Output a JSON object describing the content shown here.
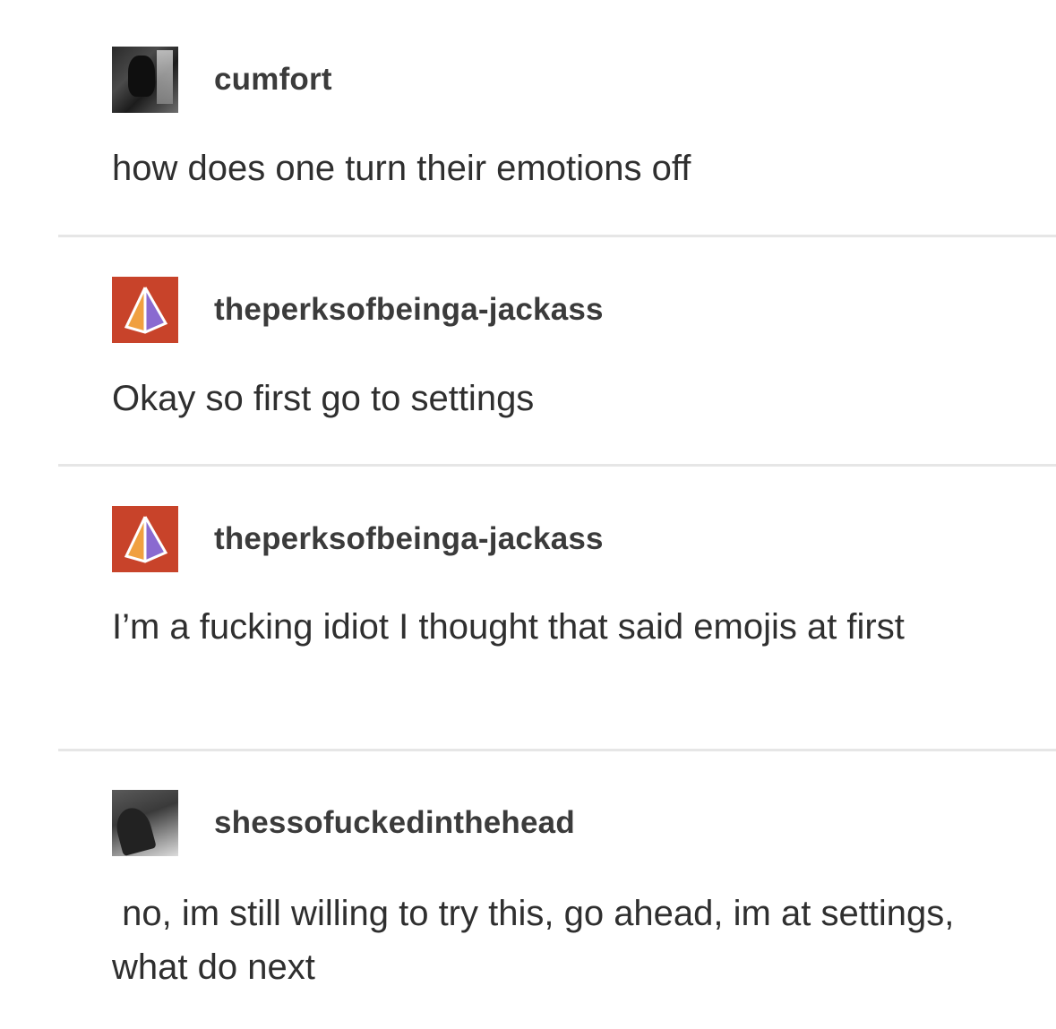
{
  "posts": [
    {
      "username": "cumfort",
      "avatar_icon": "user-photo-dark",
      "text": "how does one turn their emotions off"
    },
    {
      "username": "theperksofbeinga-jackass",
      "avatar_icon": "pyramid-icon",
      "text": "Okay so first go to settings"
    },
    {
      "username": "theperksofbeinga-jackass",
      "avatar_icon": "pyramid-icon",
      "text": "I’m a fucking idiot I thought that said emojis at first"
    },
    {
      "username": "shessofuckedinthehead",
      "avatar_icon": "user-photo-gray",
      "text": " no, im still willing to try this, go ahead, im at settings, what do next"
    }
  ],
  "colors": {
    "background": "#ffffff",
    "text": "#2f2f2f",
    "divider": "#e6e6e6",
    "pyramid_avatar_bg": "#c8432a"
  }
}
